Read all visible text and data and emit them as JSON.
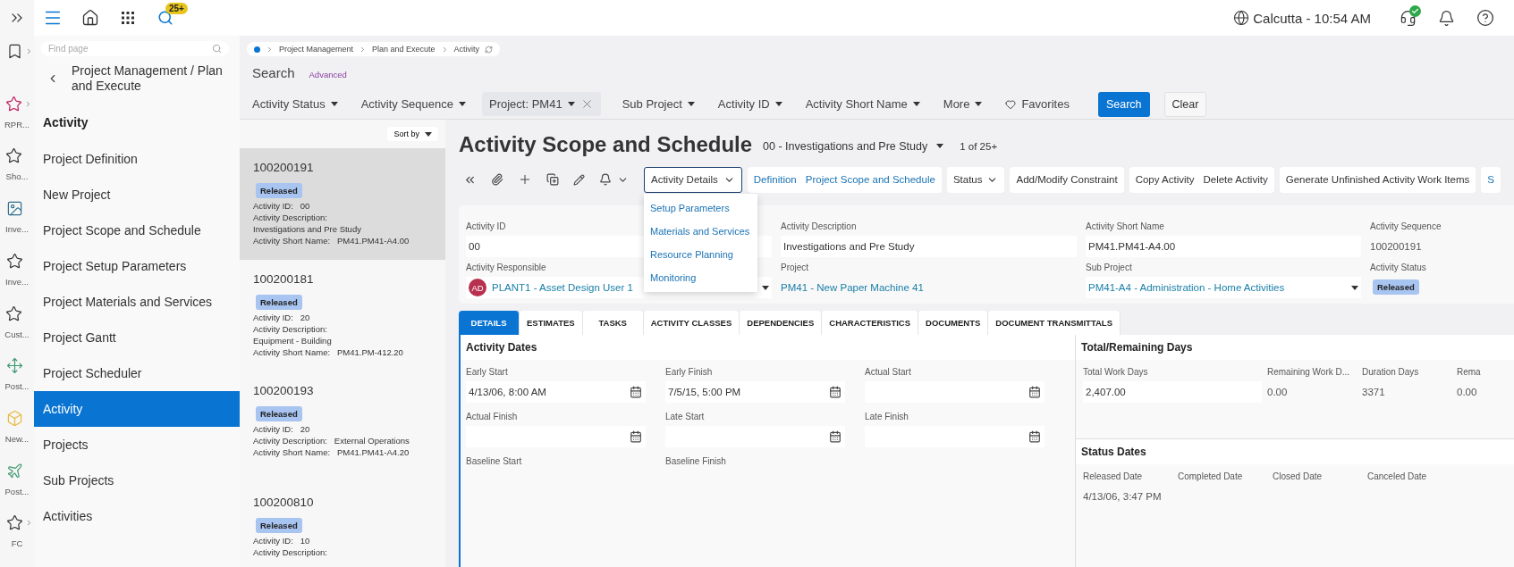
{
  "top_bar": {
    "search_badge": "25+",
    "clock": "Calcutta - 10:54 AM",
    "support_online": true
  },
  "rail": [
    {
      "kind": "bookmark",
      "expandable": true
    },
    {
      "kind": "accent-star",
      "label": "RPR...",
      "expandable": true
    },
    {
      "kind": "star",
      "label": "Sho...",
      "expandable": false
    },
    {
      "kind": "image",
      "label": "Inve...",
      "expandable": false
    },
    {
      "kind": "star",
      "label": "Inve...",
      "expandable": false
    },
    {
      "kind": "star",
      "label": "Cust...",
      "expandable": false
    },
    {
      "kind": "move",
      "label": "Post...",
      "expandable": false
    },
    {
      "kind": "cube",
      "label": "New...",
      "expandable": false
    },
    {
      "kind": "plane",
      "label": "Post...",
      "expandable": false
    },
    {
      "kind": "star",
      "label": "FC",
      "expandable": true
    }
  ],
  "nav": {
    "search_placeholder": "Find page",
    "back_title": "Project Management / Plan and Execute",
    "section": "Activity",
    "items": [
      {
        "label": "Project Definition",
        "selected": false
      },
      {
        "label": "New Project",
        "selected": false
      },
      {
        "label": "Project Scope and Schedule",
        "selected": false
      },
      {
        "label": "Project Setup Parameters",
        "selected": false
      },
      {
        "label": "Project Materials and Services",
        "selected": false
      },
      {
        "label": "Project Gantt",
        "selected": false
      },
      {
        "label": "Project Scheduler",
        "selected": false
      },
      {
        "label": "Activity",
        "selected": true
      },
      {
        "label": "Projects",
        "selected": false
      },
      {
        "label": "Sub Projects",
        "selected": false
      },
      {
        "label": "Activities",
        "selected": false
      }
    ]
  },
  "breadcrumb": [
    "Project Management",
    "Plan and Execute",
    "Activity"
  ],
  "search": {
    "title": "Search",
    "advanced": "Advanced",
    "filters": [
      {
        "label": "Activity Status",
        "kind": "dropdown"
      },
      {
        "label": "Activity Sequence",
        "kind": "dropdown"
      },
      {
        "label": "Project: PM41",
        "kind": "chip"
      },
      {
        "label": "Sub Project",
        "kind": "dropdown"
      },
      {
        "label": "Activity ID",
        "kind": "dropdown"
      },
      {
        "label": "Activity Short Name",
        "kind": "dropdown"
      },
      {
        "label": "More",
        "kind": "dropdown"
      },
      {
        "label": "Favorites",
        "kind": "favorites"
      }
    ],
    "search_button": "Search",
    "clear_button": "Clear"
  },
  "list": {
    "sort": "Sort by",
    "cards": [
      {
        "id": "100200191",
        "status": "Released",
        "selected": true,
        "lines": [
          {
            "label": "Activity ID:",
            "value": "00",
            "kind": "inline"
          },
          {
            "label": "Activity Description:",
            "value": "Investigations and Pre Study",
            "kind": "stacked"
          },
          {
            "label": "Activity Short Name:",
            "value": "PM41.PM41-A4.00",
            "kind": "inline"
          }
        ]
      },
      {
        "id": "100200181",
        "status": "Released",
        "selected": false,
        "lines": [
          {
            "label": "Activity ID:",
            "value": "20",
            "kind": "inline"
          },
          {
            "label": "Activity Description:",
            "value": "Equipment - Building",
            "kind": "stacked"
          },
          {
            "label": "Activity Short Name:",
            "value": "PM41.PM-412.20",
            "kind": "inline"
          }
        ]
      },
      {
        "id": "100200193",
        "status": "Released",
        "selected": false,
        "lines": [
          {
            "label": "Activity ID:",
            "value": "20",
            "kind": "inline"
          },
          {
            "label": "Activity Description:",
            "value": "External Operations",
            "kind": "inline"
          },
          {
            "label": "Activity Short Name:",
            "value": "PM41.PM41-A4.20",
            "kind": "inline"
          }
        ]
      },
      {
        "id": "100200810",
        "status": "Released",
        "selected": false,
        "lines": [
          {
            "label": "Activity ID:",
            "value": "10",
            "kind": "inline"
          },
          {
            "label": "Activity Description:",
            "kind": "inline"
          }
        ]
      }
    ]
  },
  "detail": {
    "title": "Activity Scope and Schedule",
    "record": "00 - Investigations and Pre Study",
    "count": "1 of 25+",
    "menu_button": {
      "label": "Activity Details",
      "expanded": true,
      "items": [
        "Setup Parameters",
        "Materials and Services",
        "Resource Planning",
        "Monitoring"
      ]
    },
    "button_groups": [
      [
        {
          "label": "Definition",
          "kind": "link"
        },
        {
          "label": "Project Scope and Schedule",
          "kind": "link"
        }
      ],
      [
        {
          "label": "Status",
          "kind": "dropdown"
        }
      ],
      [
        {
          "label": "Add/Modify Constraint",
          "kind": "action"
        }
      ],
      [
        {
          "label": "Copy Activity",
          "kind": "action"
        },
        {
          "label": "Delete Activity",
          "kind": "action"
        }
      ],
      [
        {
          "label": "Generate Unfinished Activity Work Items",
          "kind": "action"
        }
      ],
      [
        {
          "label": "S",
          "kind": "link"
        }
      ]
    ],
    "fields": [
      {
        "label": "Activity ID",
        "value": "00",
        "kind": "input"
      },
      {
        "label": "Activity Description",
        "value": "Investigations and Pre Study",
        "kind": "input"
      },
      {
        "label": "Activity Short Name",
        "value": "PM41.PM41-A4.00",
        "kind": "input"
      },
      {
        "label": "Activity Sequence",
        "value": "100200191",
        "kind": "readonly"
      },
      {
        "label": "Activity Responsible",
        "value": "PLANT1 - Asset Design User 1",
        "avatar": "AD",
        "kind": "person"
      },
      {
        "label": "Project",
        "value": "PM41 - New Paper Machine 41",
        "kind": "link"
      },
      {
        "label": "Sub Project",
        "value": "PM41-A4 - Administration - Home Activities",
        "kind": "lookup"
      },
      {
        "label": "Activity Status",
        "value": "Released",
        "kind": "badge"
      }
    ],
    "tabs": [
      {
        "label": "DETAILS",
        "selected": true
      },
      {
        "label": "ESTIMATES",
        "selected": false
      },
      {
        "label": "TASKS",
        "selected": false
      },
      {
        "label": "ACTIVITY CLASSES",
        "selected": false
      },
      {
        "label": "DEPENDENCIES",
        "selected": false
      },
      {
        "label": "CHARACTERISTICS",
        "selected": false
      },
      {
        "label": "DOCUMENTS",
        "selected": false
      },
      {
        "label": "DOCUMENT TRANSMITTALS",
        "selected": false
      }
    ],
    "activity_dates": {
      "title": "Activity Dates",
      "fields": [
        {
          "label": "Early Start",
          "value": "4/13/06, 8:00 AM",
          "kind": "date"
        },
        {
          "label": "Early Finish",
          "value": "7/5/15, 5:00 PM",
          "kind": "date"
        },
        {
          "label": "Actual Start",
          "kind": "date"
        },
        {
          "label": "Actual Finish",
          "kind": "date"
        },
        {
          "label": "Late Start",
          "kind": "date"
        },
        {
          "label": "Late Finish",
          "kind": "date"
        },
        {
          "label": "Baseline Start",
          "kind": "plain"
        },
        {
          "label": "Baseline Finish",
          "kind": "plain"
        }
      ]
    },
    "total_days": {
      "title": "Total/Remaining Days",
      "fields": [
        {
          "label": "Total Work Days",
          "value": "2,407.00",
          "kind": "input"
        },
        {
          "label": "Remaining Work D...",
          "value": "0.00",
          "kind": "readonly"
        },
        {
          "label": "Duration Days",
          "value": "3371",
          "kind": "readonly"
        },
        {
          "label": "Rema",
          "value": "0.00",
          "kind": "readonly"
        }
      ]
    },
    "status_dates": {
      "title": "Status Dates",
      "fields": [
        {
          "label": "Released Date",
          "value": "4/13/06, 3:47 PM"
        },
        {
          "label": "Completed Date"
        },
        {
          "label": "Closed Date"
        },
        {
          "label": "Canceled Date"
        }
      ]
    }
  }
}
